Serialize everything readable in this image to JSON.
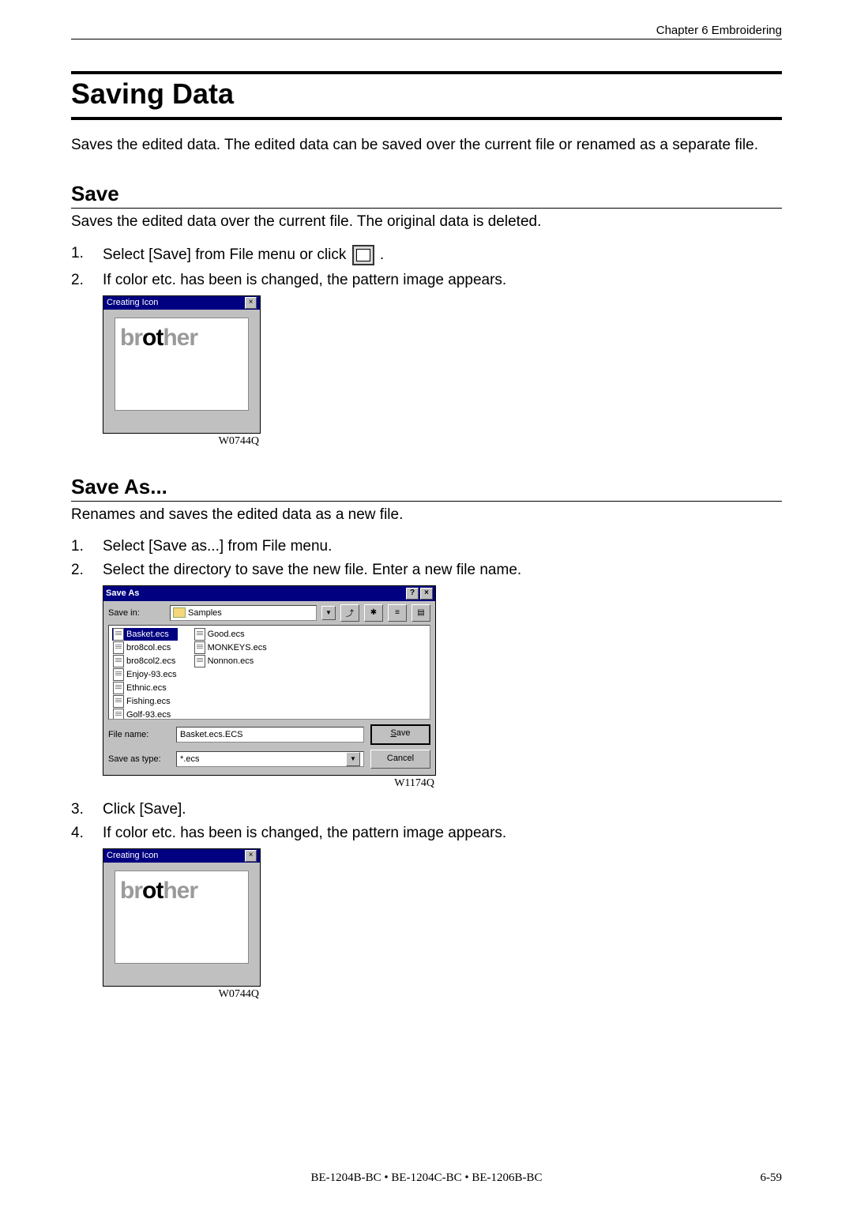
{
  "header": {
    "chapter": "Chapter 6    Embroidering"
  },
  "title": "Saving Data",
  "intro": "Saves the edited data.    The edited data can be saved over the current file or renamed as a separate file.",
  "save": {
    "heading": "Save",
    "desc": "Saves the edited data over the current file.    The original data is deleted.",
    "steps": {
      "s1_pre": "Select [Save] from File menu or click ",
      "s1_post": ".",
      "s2": "If color etc. has been is changed, the pattern image appears."
    }
  },
  "saveas": {
    "heading": "Save As...",
    "desc": "Renames and saves the edited data as a new file.",
    "steps": {
      "s1": "Select [Save as...] from File menu.",
      "s2": "Select the directory to save the new file.    Enter a new file name.",
      "s3": "Click [Save].",
      "s4": "If color etc. has been is changed, the pattern image appears."
    }
  },
  "creatingIcon": {
    "title": "Creating Icon",
    "close": "×",
    "logo_plain_a": "br",
    "logo_accent": "ot",
    "logo_plain_b": "her",
    "code": "W0744Q"
  },
  "saveAsDlg": {
    "title": "Save As",
    "help": "?",
    "close": "×",
    "saveIn_label": "Save in:",
    "saveIn_value": "Samples",
    "col1": [
      "Basket.ecs",
      "bro8col.ecs",
      "bro8col2.ecs",
      "Enjoy-93.ecs",
      "Ethnic.ecs",
      "Fishing.ecs",
      "Golf-93.ecs"
    ],
    "col2": [
      "Good.ecs",
      "MONKEYS.ecs",
      "Nonnon.ecs"
    ],
    "fileName_label": "File name:",
    "fileName_value": "Basket.ecs.ECS",
    "saveType_label": "Save as type:",
    "saveType_value": "*.ecs",
    "btn_save": "Save",
    "btn_cancel": "Cancel",
    "toolUp": "⤴",
    "toolNew": "✱",
    "toolList": "≡",
    "toolDetail": "▤",
    "arrow": "▼",
    "code": "W1174Q"
  },
  "nums": {
    "n1": "1.",
    "n2": "2.",
    "n3": "3.",
    "n4": "4."
  },
  "footer": {
    "models": "BE-1204B-BC • BE-1204C-BC • BE-1206B-BC",
    "page": "6-59"
  }
}
